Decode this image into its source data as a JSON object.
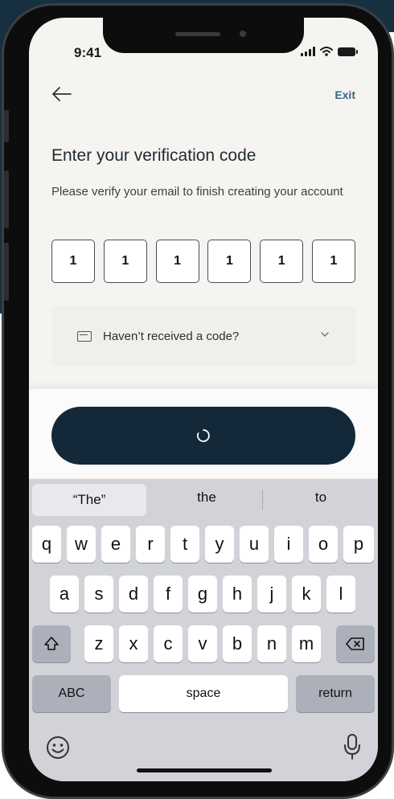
{
  "status_bar": {
    "time": "9:41"
  },
  "header": {
    "exit_label": "Exit"
  },
  "main": {
    "title": "Enter your verification code",
    "subtitle": "Please verify your email to finish creating your account",
    "code_digits": [
      "1",
      "1",
      "1",
      "1",
      "1",
      "1"
    ],
    "resend_label": "Haven’t received a code?"
  },
  "primary_button": {
    "state": "loading"
  },
  "keyboard": {
    "suggestions": [
      "“The”",
      "the",
      "to"
    ],
    "row1": [
      "q",
      "w",
      "e",
      "r",
      "t",
      "y",
      "u",
      "i",
      "o",
      "p"
    ],
    "row2": [
      "a",
      "s",
      "d",
      "f",
      "g",
      "h",
      "j",
      "k",
      "l"
    ],
    "row3": [
      "z",
      "x",
      "c",
      "v",
      "b",
      "n",
      "m"
    ],
    "abc_label": "ABC",
    "space_label": "space",
    "return_label": "return"
  },
  "colors": {
    "accent_dark": "#13293a",
    "link": "#2e6a8a",
    "screen_bg": "#f6f4f1",
    "keyboard_bg": "#d1d3d9"
  }
}
